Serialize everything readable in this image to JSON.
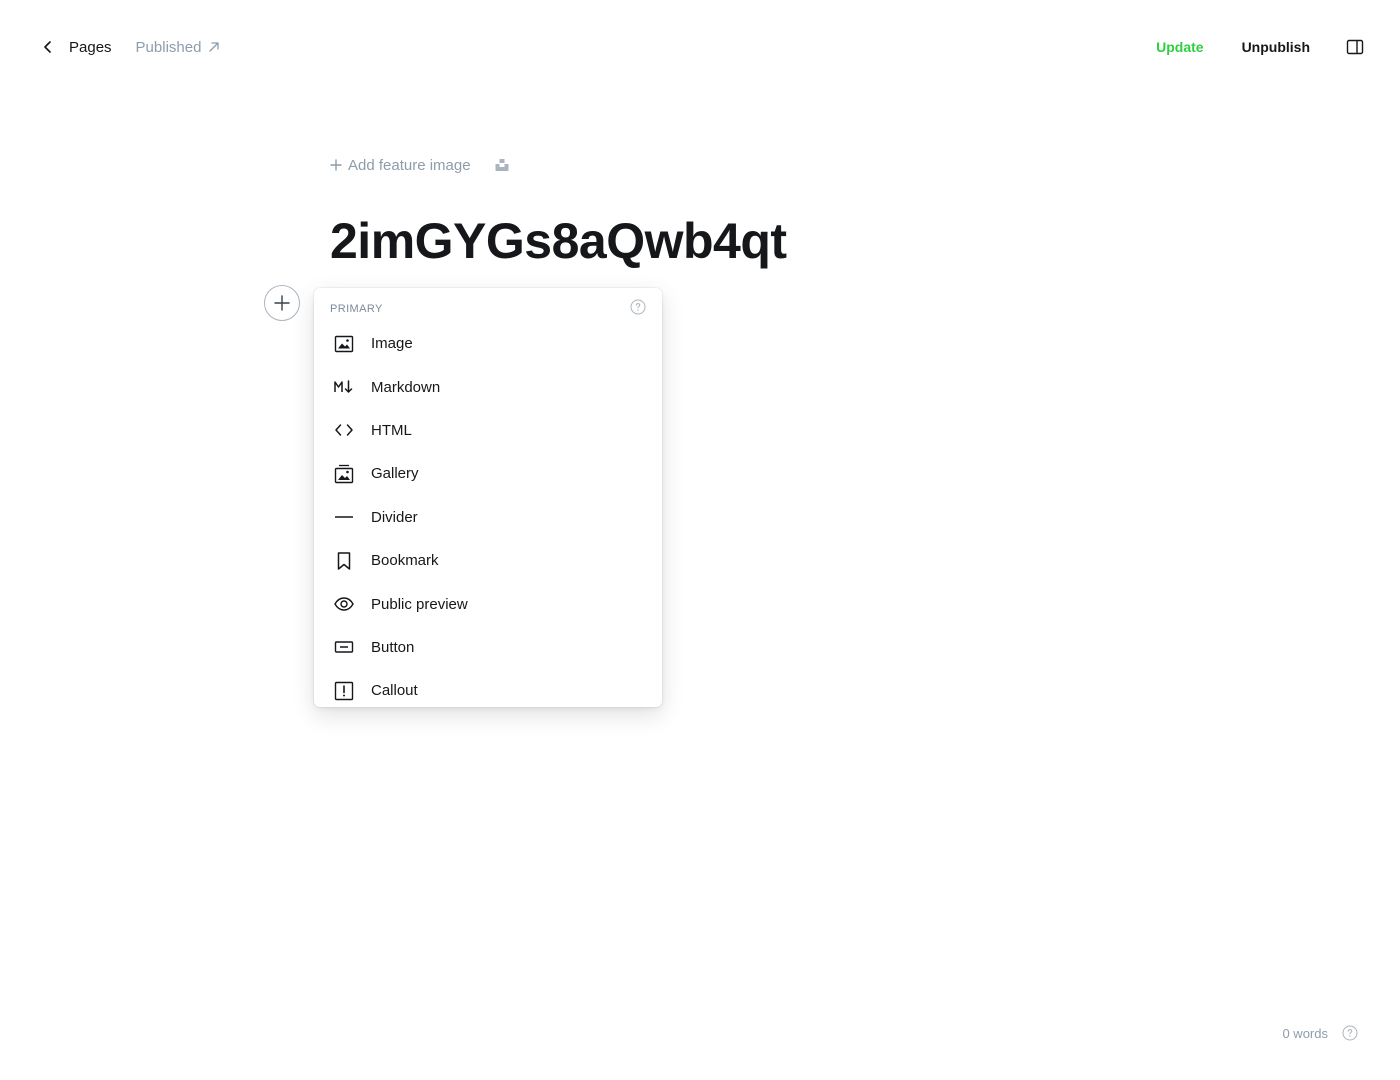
{
  "topbar": {
    "back_label": "Pages",
    "status_label": "Published",
    "update_label": "Update",
    "unpublish_label": "Unpublish",
    "accent_color": "#30cf43"
  },
  "editor": {
    "add_feature_image_label": "Add feature image",
    "title": "2imGYGs8aQwb4qt"
  },
  "card_menu": {
    "section_label": "PRIMARY",
    "items": [
      {
        "label": "Image",
        "icon": "image-icon"
      },
      {
        "label": "Markdown",
        "icon": "markdown-icon"
      },
      {
        "label": "HTML",
        "icon": "code-icon"
      },
      {
        "label": "Gallery",
        "icon": "gallery-icon"
      },
      {
        "label": "Divider",
        "icon": "divider-icon"
      },
      {
        "label": "Bookmark",
        "icon": "bookmark-icon"
      },
      {
        "label": "Public preview",
        "icon": "eye-icon"
      },
      {
        "label": "Button",
        "icon": "button-icon"
      },
      {
        "label": "Callout",
        "icon": "callout-icon"
      }
    ]
  },
  "footer": {
    "word_count": "0 words"
  }
}
